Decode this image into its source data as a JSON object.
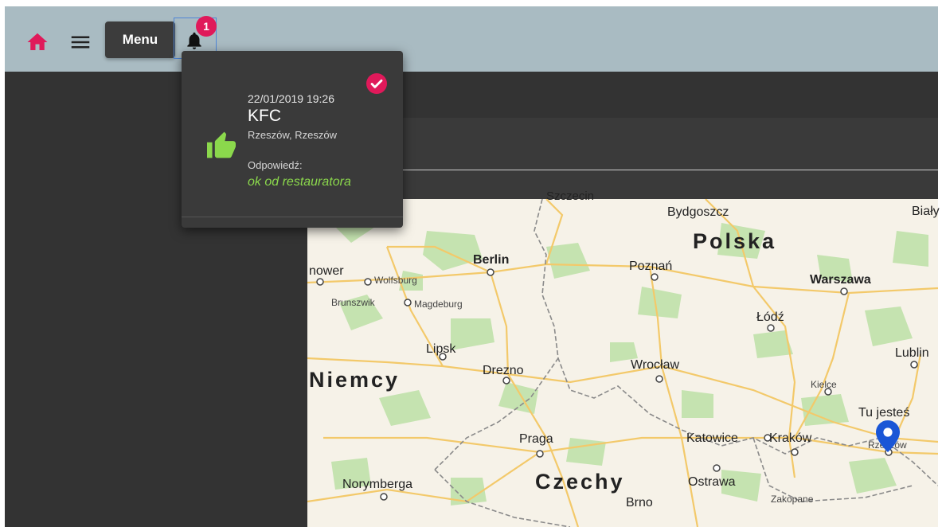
{
  "header": {
    "home_icon": "home-icon",
    "menu_icon": "hamburger-icon",
    "menu_label": "Menu",
    "notification_icon": "bell-icon",
    "notification_count": "1",
    "accent_color": "#e0195a",
    "bar_color": "#a9bbc2"
  },
  "notification": {
    "date": "22/01/2019 19:26",
    "title": "KFC",
    "location": "Rzeszów, Rzeszów",
    "response_label": "Odpowiedź:",
    "response_text": "ok od restauratora",
    "status_icon": "check-circle-icon",
    "rating_icon": "thumbs-up-icon",
    "response_color": "#8bd84c"
  },
  "map": {
    "countries": [
      "Polska",
      "Niemcy",
      "Czechy"
    ],
    "cities": [
      "Szczecin",
      "Bydgoszcz",
      "Biały",
      "Berlin",
      "Poznań",
      "Warszawa",
      "nower",
      "Wolfsburg",
      "Brunszwik",
      "Magdeburg",
      "Łódź",
      "Lipsk",
      "Drezno",
      "Wrocław",
      "Lublin",
      "Kielce",
      "Praga",
      "Katowice",
      "Kraków",
      "Rzeszów",
      "Norymberga",
      "Ostrawa",
      "Brno",
      "Zakopane"
    ],
    "you_are_here": "Tu jesteś",
    "marker_icon": "map-pin-icon"
  }
}
